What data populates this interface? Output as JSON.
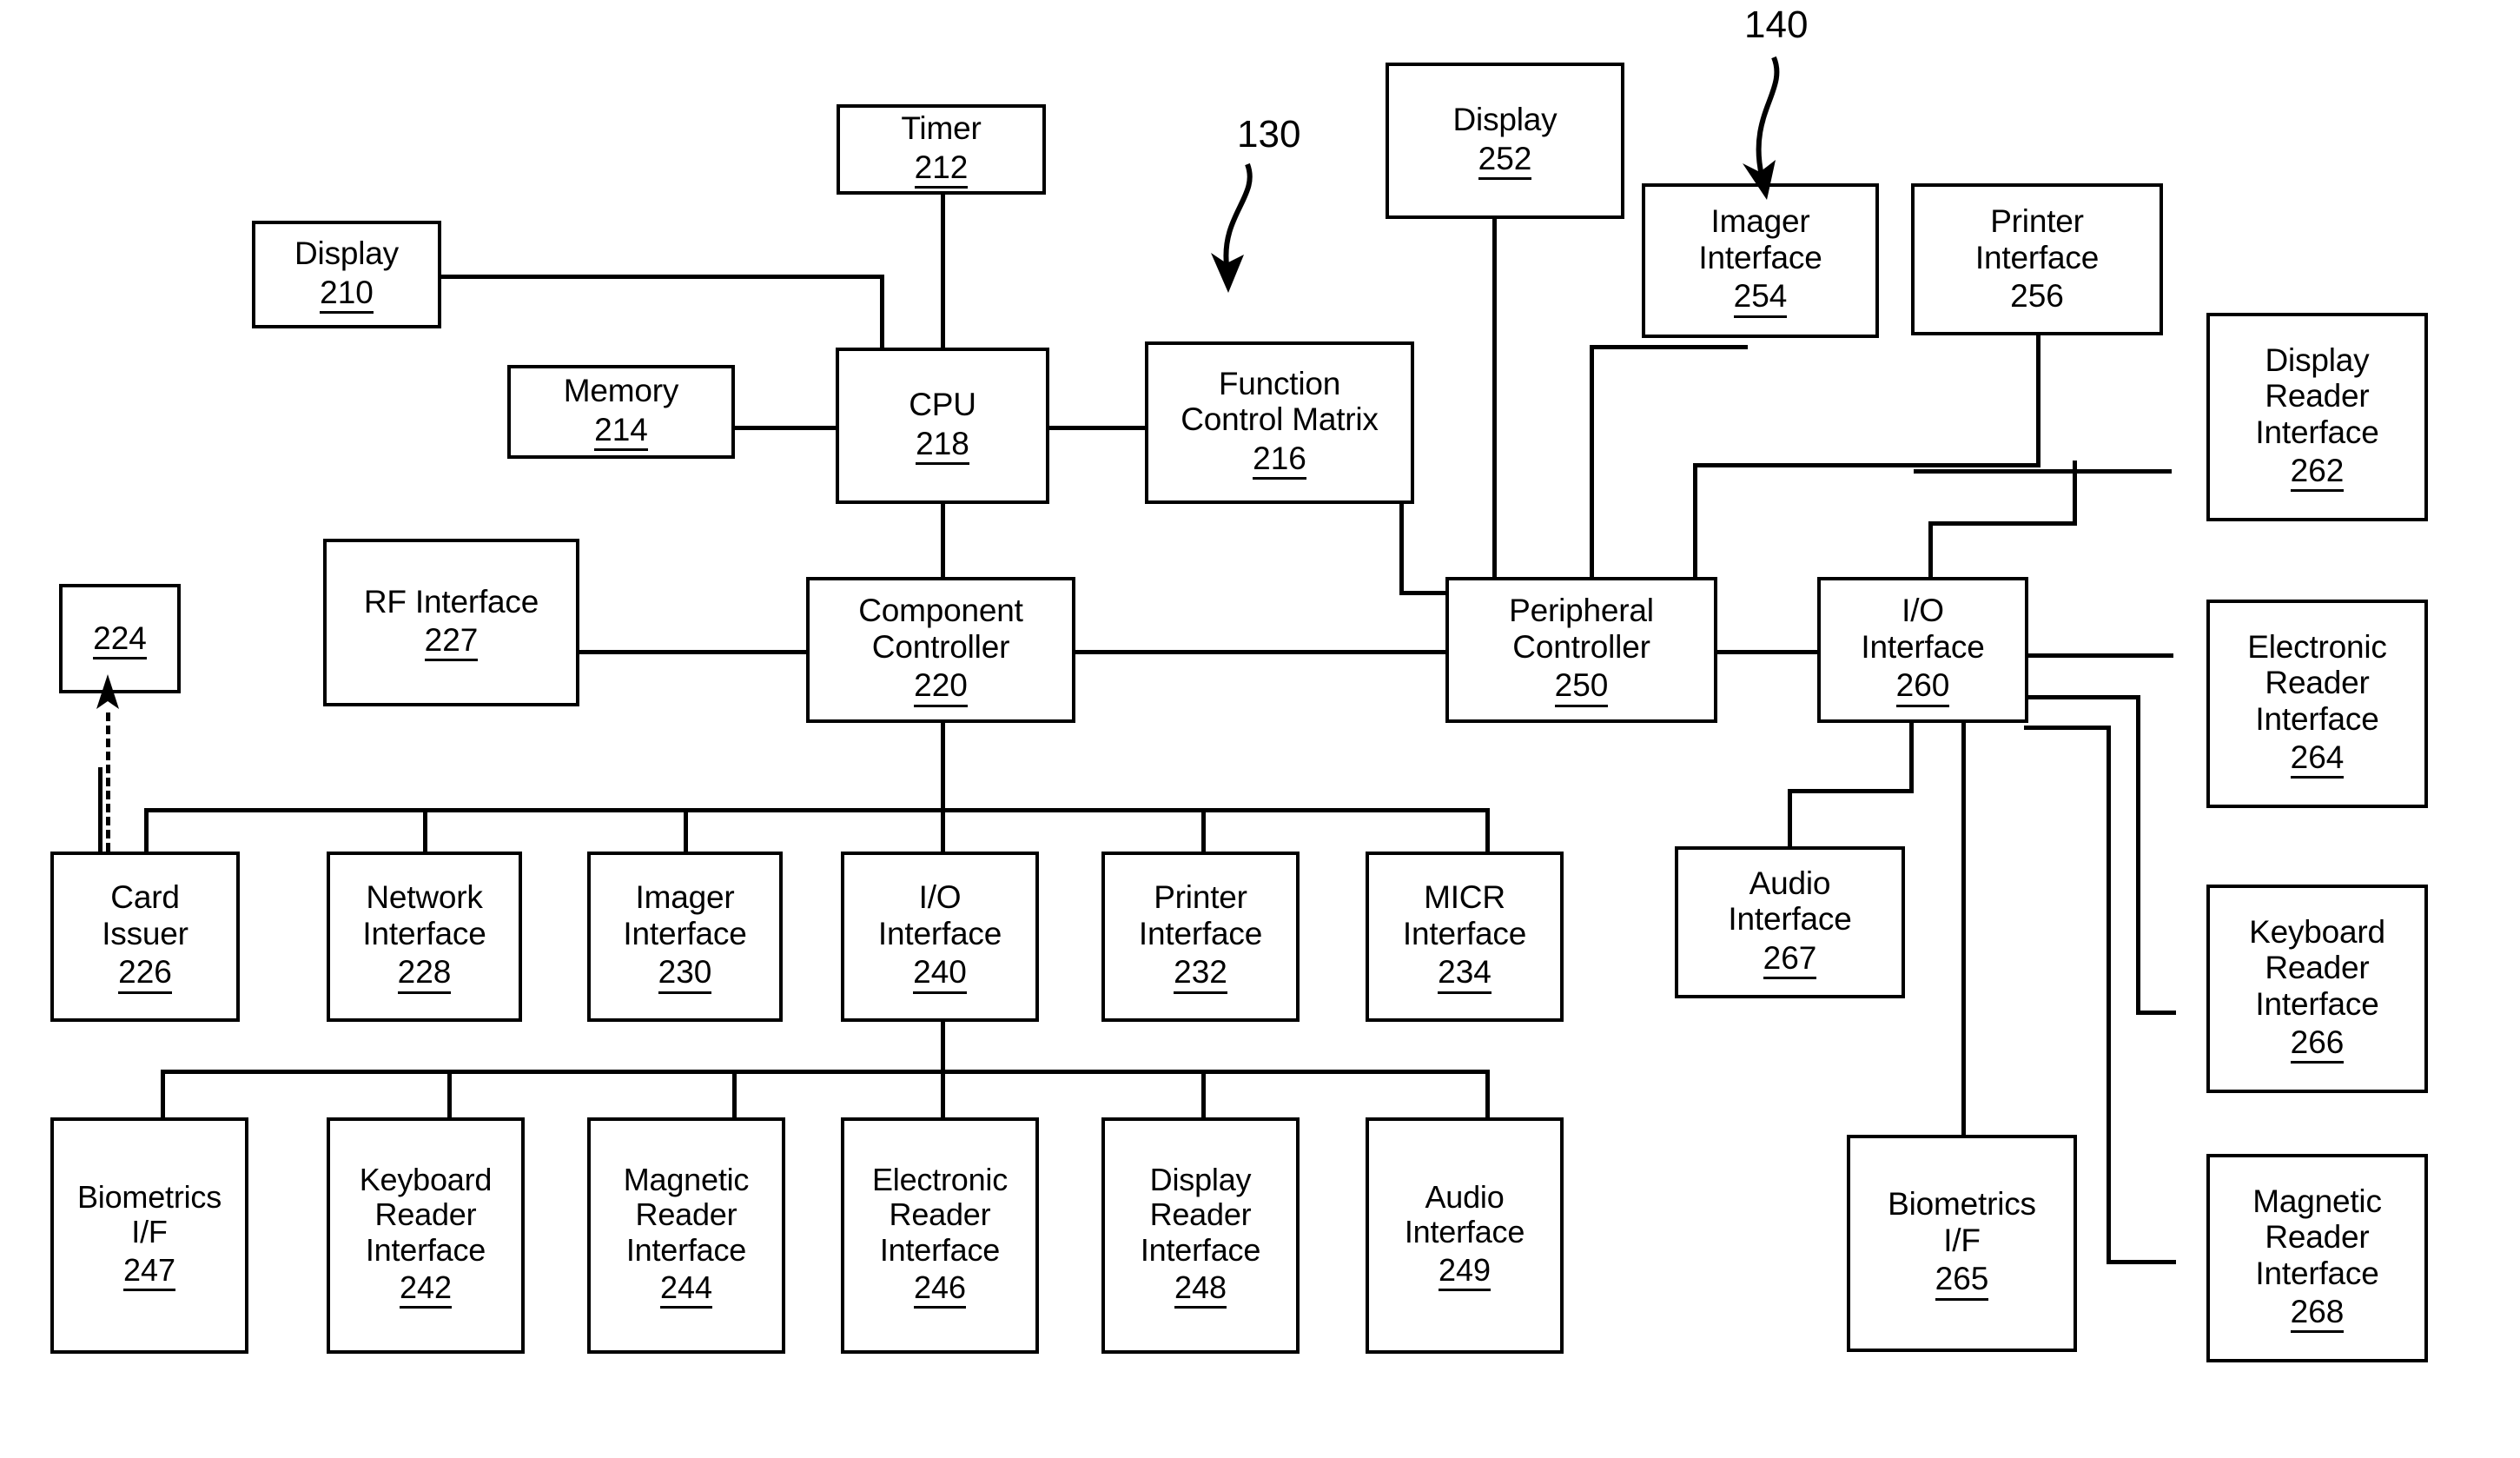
{
  "figure": {
    "type": "patent-block-diagram",
    "background": "#ffffff",
    "line_color": "#000000",
    "reference_callouts": [
      {
        "id": "callout-130",
        "text": "130"
      },
      {
        "id": "callout-140",
        "text": "140"
      }
    ]
  },
  "nodes": {
    "display_210": {
      "label": "Display",
      "number": "210",
      "underline": true
    },
    "timer_212": {
      "label": "Timer",
      "number": "212",
      "underline": true
    },
    "memory_214": {
      "label": "Memory",
      "number": "214",
      "underline": true
    },
    "cpu_218": {
      "label": "CPU",
      "number": "218",
      "underline": true
    },
    "function_matrix_216": {
      "label": "Function\nControl Matrix",
      "number": "216",
      "underline": true
    },
    "display_252": {
      "label": "Display",
      "number": "252",
      "underline": true
    },
    "imager_if_254": {
      "label": "Imager\nInterface",
      "number": "254",
      "underline": true
    },
    "printer_if_256": {
      "label": "Printer\nInterface",
      "number": "256",
      "underline": false
    },
    "display_reader_262": {
      "label": "Display\nReader\nInterface",
      "number": "262",
      "underline": true
    },
    "box_224": {
      "label": "",
      "number": "224",
      "underline": true
    },
    "rf_interface_227": {
      "label": "RF Interface",
      "number": "227",
      "underline": true
    },
    "component_ctrl_220": {
      "label": "Component\nController",
      "number": "220",
      "underline": true
    },
    "peripheral_ctrl_250": {
      "label": "Peripheral\nController",
      "number": "250",
      "underline": true
    },
    "io_interface_260": {
      "label": "I/O\nInterface",
      "number": "260",
      "underline": true
    },
    "electronic_reader_264": {
      "label": "Electronic\nReader\nInterface",
      "number": "264",
      "underline": true
    },
    "card_issuer_226": {
      "label": "Card\nIssuer",
      "number": "226",
      "underline": true
    },
    "network_if_228": {
      "label": "Network\nInterface",
      "number": "228",
      "underline": true
    },
    "imager_if_230": {
      "label": "Imager\nInterface",
      "number": "230",
      "underline": true
    },
    "io_interface_240": {
      "label": "I/O\nInterface",
      "number": "240",
      "underline": true
    },
    "printer_if_232": {
      "label": "Printer\nInterface",
      "number": "232",
      "underline": true
    },
    "micr_if_234": {
      "label": "MICR\nInterface",
      "number": "234",
      "underline": true
    },
    "audio_if_267": {
      "label": "Audio\nInterface",
      "number": "267",
      "underline": true
    },
    "keyboard_reader_266": {
      "label": "Keyboard\nReader\nInterface",
      "number": "266",
      "underline": true
    },
    "biometrics_if_247": {
      "label": "Biometrics\nI/F",
      "number": "247",
      "underline": true
    },
    "keyboard_reader_242": {
      "label": "Keyboard\nReader\nInterface",
      "number": "242",
      "underline": true
    },
    "magnetic_reader_244": {
      "label": "Magnetic\nReader\nInterface",
      "number": "244",
      "underline": true
    },
    "electronic_reader_246": {
      "label": "Electronic\nReader\nInterface",
      "number": "246",
      "underline": true
    },
    "display_reader_248": {
      "label": "Display\nReader\nInterface",
      "number": "248",
      "underline": true
    },
    "audio_if_249": {
      "label": "Audio\nInterface",
      "number": "249",
      "underline": true
    },
    "biometrics_if_265": {
      "label": "Biometrics\nI/F",
      "number": "265",
      "underline": true
    },
    "magnetic_reader_268": {
      "label": "Magnetic\nReader\nInterface",
      "number": "268",
      "underline": true
    }
  }
}
